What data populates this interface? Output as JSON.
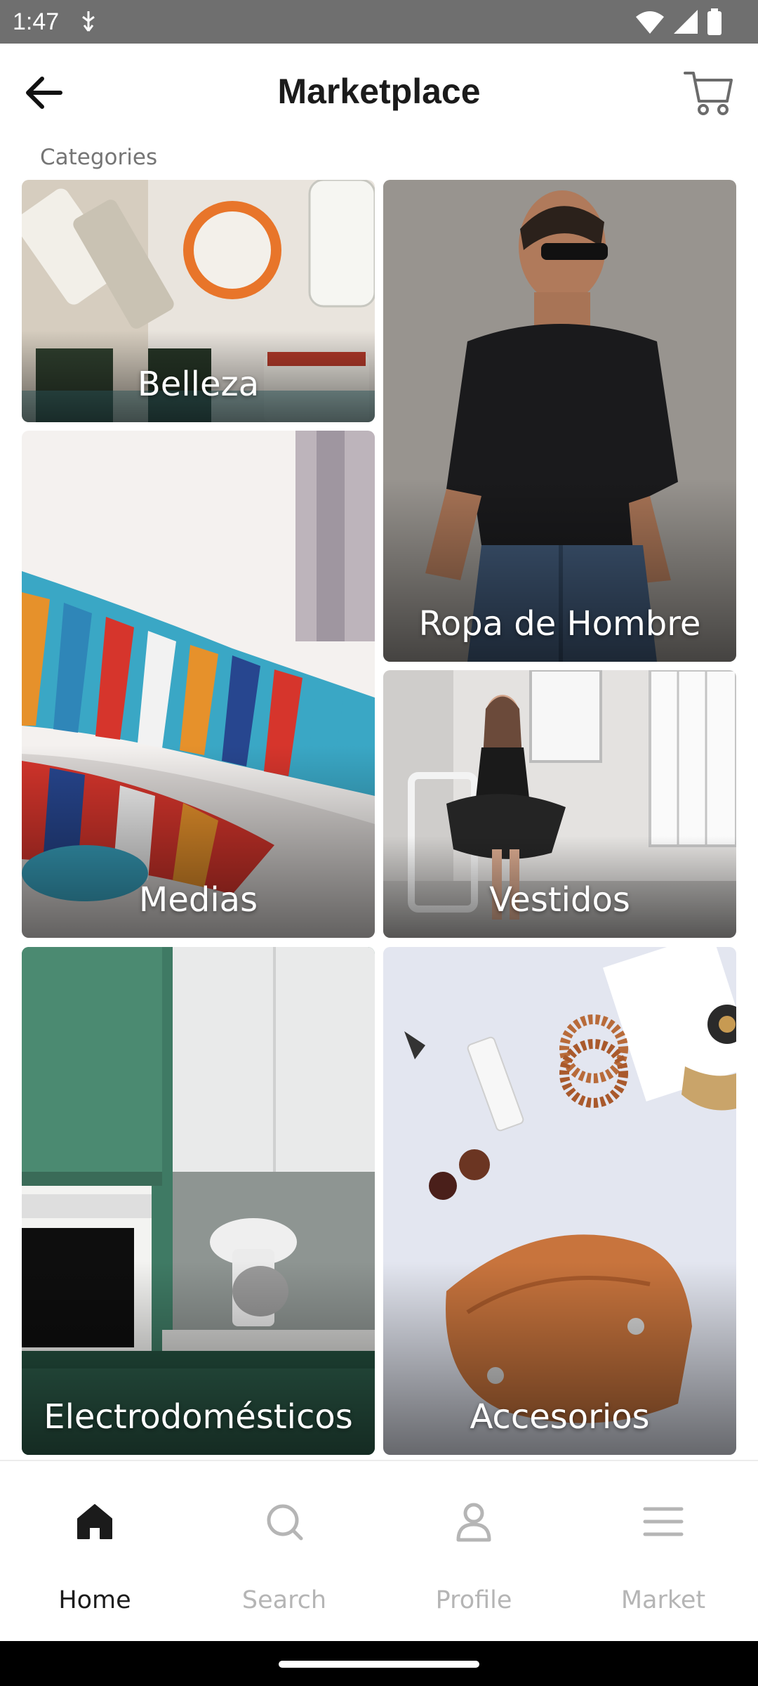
{
  "status_bar": {
    "time": "1:47",
    "icons": [
      "usb-debug-icon",
      "wifi-icon",
      "signal-icon",
      "battery-icon"
    ]
  },
  "app_bar": {
    "title": "Marketplace",
    "back_icon": "arrow-left-icon",
    "cart_icon": "cart-icon"
  },
  "section_label": "Categories",
  "categories": [
    {
      "label": "Belleza"
    },
    {
      "label": "Ropa de Hombre"
    },
    {
      "label": "Medias"
    },
    {
      "label": "Vestidos"
    },
    {
      "label": "Electrodomésticos"
    },
    {
      "label": "Accesorios"
    }
  ],
  "bottom_nav": {
    "items": [
      {
        "label": "Home",
        "icon": "home-icon",
        "active": true
      },
      {
        "label": "Search",
        "icon": "search-icon",
        "active": false
      },
      {
        "label": "Profile",
        "icon": "profile-icon",
        "active": false
      },
      {
        "label": "Market",
        "icon": "menu-icon",
        "active": false
      }
    ],
    "active_color": "#1b1b1b",
    "inactive_color": "#b5b5b5"
  },
  "colors": {
    "status_bar": "#6f6f6f",
    "title": "#1b1b1b",
    "section_label": "#757575"
  }
}
